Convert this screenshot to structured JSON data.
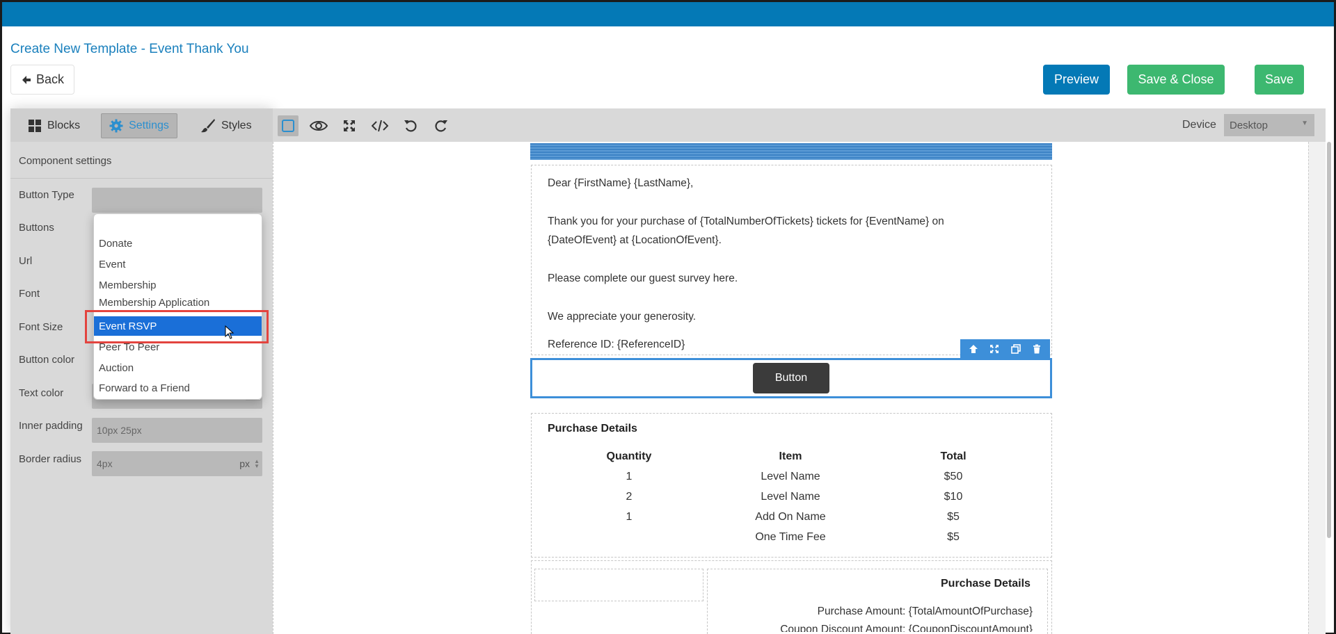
{
  "header": {
    "title": "Create New Template - Event Thank You",
    "back_label": "Back",
    "preview_label": "Preview",
    "save_close_label": "Save & Close",
    "save_label": "Save"
  },
  "left_panel": {
    "tabs": [
      {
        "label": "Blocks",
        "icon": "blocks-icon"
      },
      {
        "label": "Settings",
        "icon": "gear-icon"
      },
      {
        "label": "Styles",
        "icon": "paintbrush-icon"
      }
    ],
    "section_title": "Component settings",
    "rows": {
      "button_type": "Button Type",
      "buttons": "Buttons",
      "url": "Url",
      "font": "Font",
      "font_size": "Font Size",
      "button_color": "Button color",
      "text_color": "Text color",
      "inner_padding": "Inner padding",
      "border_radius": "Border radius"
    },
    "inner_padding_value": "10px 25px",
    "border_radius_value": "4px",
    "border_radius_unit": "px"
  },
  "dropdown": {
    "options": [
      "Donate",
      "Event",
      "Membership",
      "Membership Application",
      "Event RSVP",
      "Peer To Peer",
      "Auction",
      "Forward to a Friend"
    ],
    "selected": "Event RSVP"
  },
  "editor_toolbar": {
    "device_label": "Device",
    "device_value": "Desktop"
  },
  "email": {
    "greeting": "Dear {FirstName} {LastName},",
    "thanks_line1": "Thank you for your purchase of {TotalNumberOfTickets} tickets for {EventName} on",
    "thanks_line2": "{DateOfEvent} at {LocationOfEvent}.",
    "survey": "Please complete our guest survey here.",
    "appreciate": "We appreciate your generosity.",
    "reference": "Reference ID: {ReferenceID}",
    "button_label": "Button",
    "purchase_details_title": "Purchase Details",
    "table": {
      "headers": [
        "Quantity",
        "Item",
        "Total"
      ],
      "rows": [
        [
          "1",
          "Level Name",
          "$50"
        ],
        [
          "2",
          "Level Name",
          "$10"
        ],
        [
          "1",
          "Add On Name",
          "$5"
        ],
        [
          "",
          "One Time Fee",
          "$5"
        ]
      ]
    },
    "summary_title": "Purchase Details",
    "summary_lines": [
      "Purchase Amount: {TotalAmountOfPurchase}",
      "Coupon Discount Amount: {CouponDiscountAmount}"
    ]
  },
  "colors": {
    "topbar": "#0479b6",
    "preview": "#0479b6",
    "save": "#3db870",
    "selection": "#3d8fd9",
    "dropdown_selected": "#1a6fd8",
    "highlight_border": "#e3443f"
  }
}
